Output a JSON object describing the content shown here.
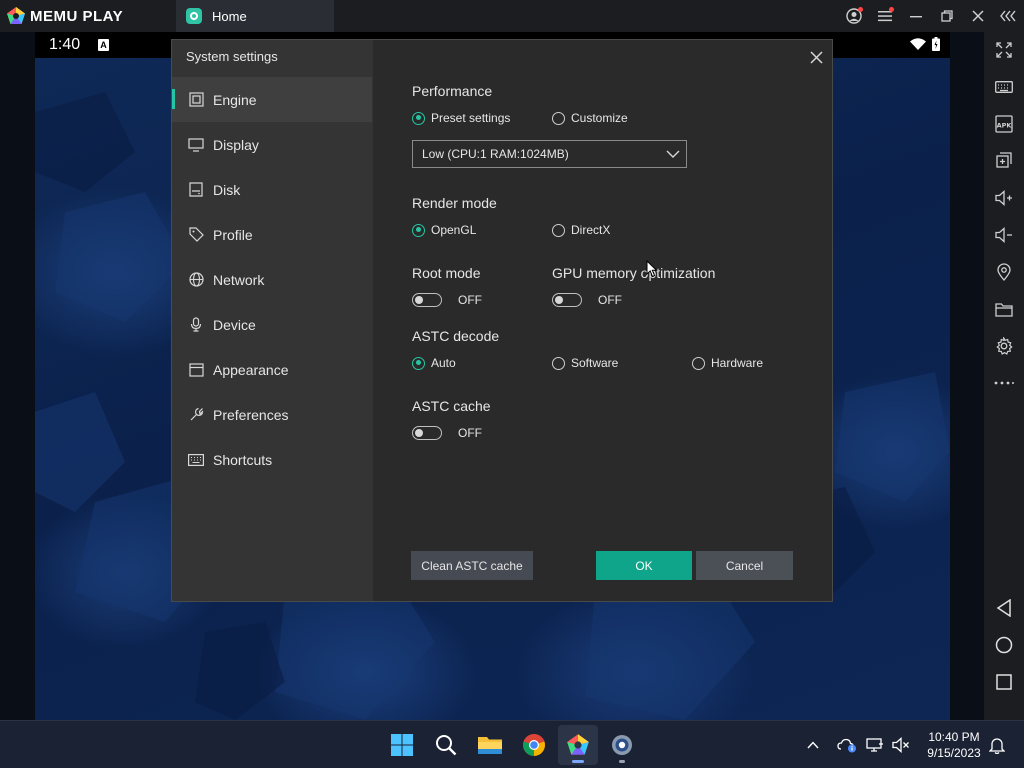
{
  "app": {
    "brand": "MEMU PLAY",
    "tab_label": "Home"
  },
  "android_status": {
    "time": "1:40"
  },
  "dialog": {
    "title": "System settings",
    "nav": [
      {
        "label": "Engine",
        "icon": "chip-icon",
        "active": true
      },
      {
        "label": "Display",
        "icon": "monitor-icon"
      },
      {
        "label": "Disk",
        "icon": "disk-icon"
      },
      {
        "label": "Profile",
        "icon": "tag-icon"
      },
      {
        "label": "Network",
        "icon": "globe-icon"
      },
      {
        "label": "Device",
        "icon": "microphone-icon"
      },
      {
        "label": "Appearance",
        "icon": "window-icon"
      },
      {
        "label": "Preferences",
        "icon": "wrench-icon"
      },
      {
        "label": "Shortcuts",
        "icon": "keyboard-icon"
      }
    ],
    "performance": {
      "label": "Performance",
      "option_preset": "Preset settings",
      "option_custom": "Customize",
      "selected": "Preset settings",
      "dropdown_value": "Low (CPU:1 RAM:1024MB)"
    },
    "render_mode": {
      "label": "Render mode",
      "option_opengl": "OpenGL",
      "option_directx": "DirectX",
      "selected": "OpenGL"
    },
    "root_mode": {
      "label": "Root mode",
      "state": "OFF"
    },
    "gpu_memory": {
      "label": "GPU memory optimization",
      "state": "OFF"
    },
    "astc_decode": {
      "label": "ASTC decode",
      "option_auto": "Auto",
      "option_software": "Software",
      "option_hardware": "Hardware",
      "selected": "Auto"
    },
    "astc_cache": {
      "label": "ASTC cache",
      "state": "OFF"
    },
    "buttons": {
      "clean": "Clean ASTC cache",
      "ok": "OK",
      "cancel": "Cancel"
    }
  },
  "taskbar": {
    "time": "10:40 PM",
    "date": "9/15/2023"
  },
  "colors": {
    "accent": "#26c6a5",
    "ok_button": "#0fa58b"
  }
}
